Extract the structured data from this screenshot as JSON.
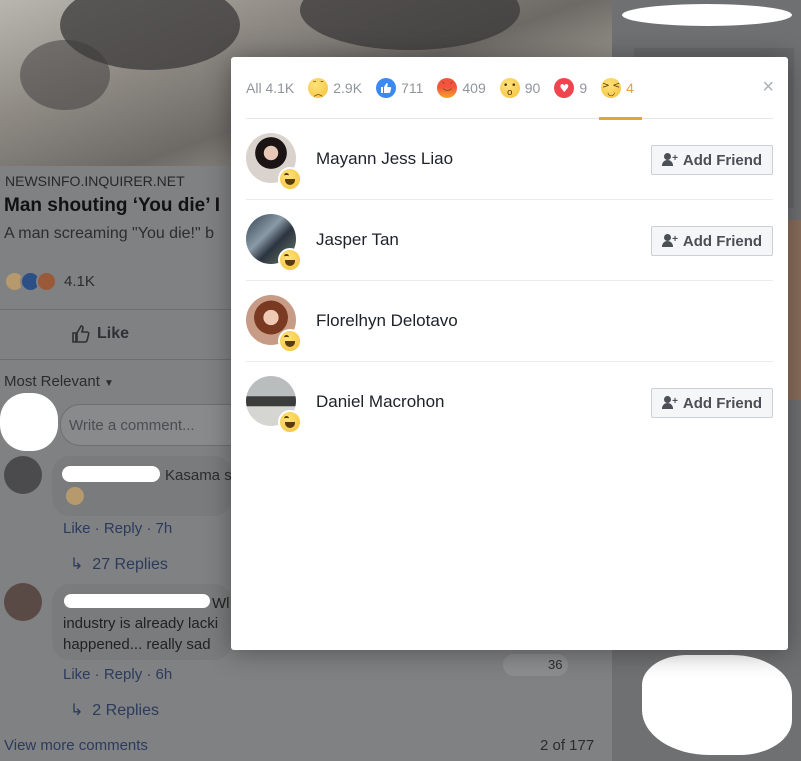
{
  "background": {
    "source": "NEWSINFO.INQUIRER.NET",
    "headline": "Man shouting ‘You die’ I",
    "subline": "A man screaming \"You die!\" b",
    "reaction_count": "4.1K",
    "like_label": "Like",
    "sort_label": "Most Relevant",
    "write_placeholder": "Write a comment...",
    "comment1": {
      "name_fragment": "Kasama s",
      "actions": "Like · Reply · 7h",
      "replies": "27 Replies"
    },
    "comment2": {
      "text_line1": "industry is already lacki",
      "text_line2": "happened... really sad",
      "name_fragment": "Wl",
      "actions": "Like · Reply · 6h",
      "replies": "2 Replies",
      "reaction_count": "36"
    },
    "view_more": "View more comments",
    "pager": "2 of 177"
  },
  "modal": {
    "tabs": [
      {
        "label": "All 4.1K",
        "icon": ""
      },
      {
        "label": "2.9K",
        "icon": "sad"
      },
      {
        "label": "711",
        "icon": "like"
      },
      {
        "label": "409",
        "icon": "angry"
      },
      {
        "label": "90",
        "icon": "wow"
      },
      {
        "label": "9",
        "icon": "love"
      },
      {
        "label": "4",
        "icon": "haha"
      }
    ],
    "active_tab_index": 6,
    "close_glyph": "×",
    "people": [
      {
        "name": "Mayann Jess Liao",
        "button": "Add Friend"
      },
      {
        "name": "Jasper Tan",
        "button": "Add Friend"
      },
      {
        "name": "Florelhyn Delotavo",
        "button": ""
      },
      {
        "name": "Daniel Macrohon",
        "button": "Add Friend"
      }
    ]
  },
  "colors": {
    "accent": "#e7a13d",
    "like_blue": "#3b89f2",
    "angry_red": "#f2543d",
    "love_red": "#f0454f"
  }
}
